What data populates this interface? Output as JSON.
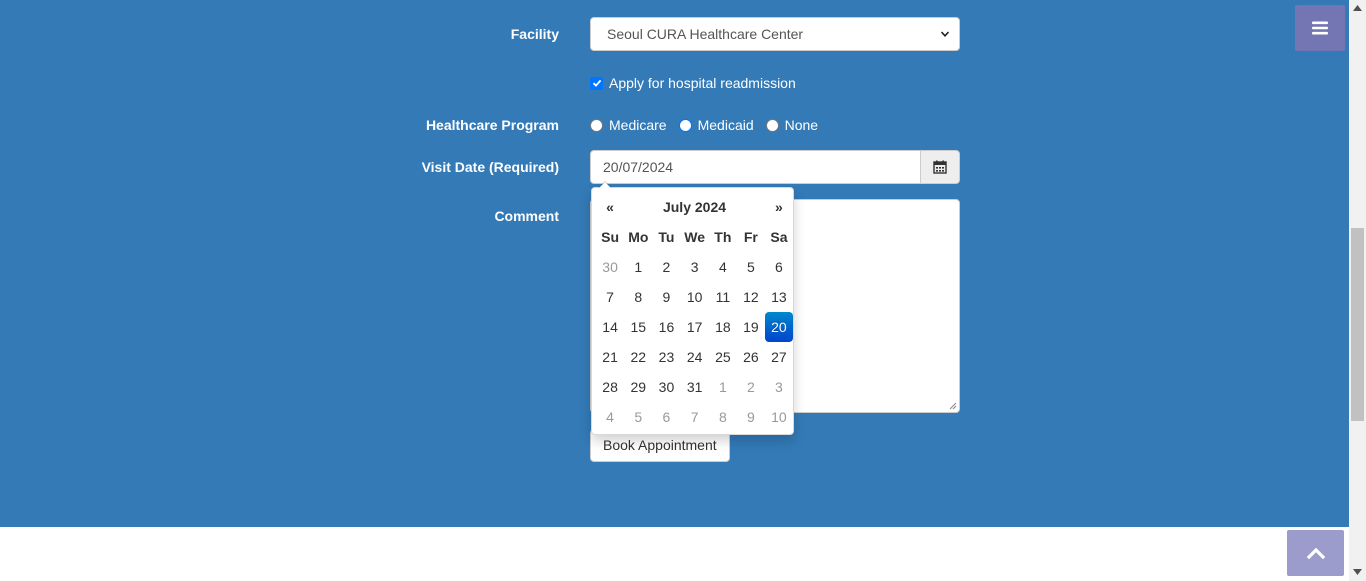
{
  "form": {
    "facility_label": "Facility",
    "facility_value": "Seoul CURA Healthcare Center",
    "readmission_label": "Apply for hospital readmission",
    "program_label": "Healthcare Program",
    "program_options": [
      "Medicare",
      "Medicaid",
      "None"
    ],
    "program_selected": "Medicaid",
    "visit_date_label": "Visit Date (Required)",
    "visit_date_value": "20/07/2024",
    "comment_label": "Comment",
    "comment_value": "",
    "book_button": "Book Appointment"
  },
  "datepicker": {
    "prev": "«",
    "next": "»",
    "month_title": "July 2024",
    "weekdays": [
      "Su",
      "Mo",
      "Tu",
      "We",
      "Th",
      "Fr",
      "Sa"
    ],
    "weeks": [
      [
        "30",
        "1",
        "2",
        "3",
        "4",
        "5",
        "6"
      ],
      [
        "7",
        "8",
        "9",
        "10",
        "11",
        "12",
        "13"
      ],
      [
        "14",
        "15",
        "16",
        "17",
        "18",
        "19",
        "20"
      ],
      [
        "21",
        "22",
        "23",
        "24",
        "25",
        "26",
        "27"
      ],
      [
        "28",
        "29",
        "30",
        "31",
        "1",
        "2",
        "3"
      ],
      [
        "4",
        "5",
        "6",
        "7",
        "8",
        "9",
        "10"
      ]
    ],
    "selected_day": "20"
  },
  "icons": {
    "menu": "hamburger-menu-icon",
    "calendar": "calendar-icon",
    "back_to_top": "chevron-up-icon"
  },
  "colors": {
    "section_bg": "#337ab7",
    "menu_button": "#7476b3",
    "top_button": "#9c9ccc",
    "selected_day": "#0066cc",
    "checkbox": "#0075ff"
  }
}
